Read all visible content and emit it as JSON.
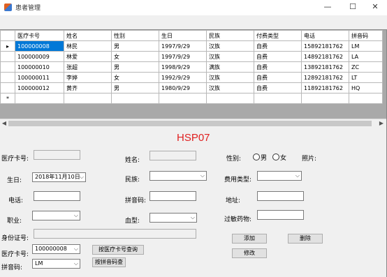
{
  "window": {
    "title": "患者管理",
    "min": "—",
    "max": "☐",
    "close": "✕"
  },
  "grid": {
    "columns": [
      "医疗卡号",
      "姓名",
      "性别",
      "生日",
      "民族",
      "付费类型",
      "电话",
      "拼音码"
    ],
    "rows": [
      [
        "100000008",
        "林民",
        "男",
        "1997/9/29",
        "汉族",
        "自费",
        "15892181762",
        "LM"
      ],
      [
        "100000009",
        "林爱",
        "女",
        "1997/9/29",
        "汉族",
        "自费",
        "14892181762",
        "LA"
      ],
      [
        "100000010",
        "张超",
        "男",
        "1998/9/29",
        "满族",
        "自费",
        "13892181762",
        "ZC"
      ],
      [
        "100000011",
        "李婷",
        "女",
        "1992/9/29",
        "汉族",
        "自费",
        "12892181762",
        "LT"
      ],
      [
        "100000012",
        "黄齐",
        "男",
        "1980/9/29",
        "汉族",
        "自费",
        "11892181762",
        "HQ"
      ]
    ],
    "current_marker": "▸",
    "new_marker": "*"
  },
  "form": {
    "heading": "HSP07",
    "card_label": "医疗卡号:",
    "name_label": "姓名:",
    "gender_label": "性别:",
    "male": "男",
    "female": "女",
    "photo_label": "照片:",
    "birthday_label": "生日:",
    "birthday_value": "2018年11月10日",
    "ethnic_label": "民族:",
    "fee_label": "费用类型:",
    "phone_label": "电话:",
    "pinyin_label": "拼音码:",
    "address_label": "地址:",
    "job_label": "职业:",
    "blood_label": "血型:",
    "allergy_label": "过敏药物:",
    "id_label": "身份证号:",
    "add_btn": "添加",
    "delete_btn": "删除",
    "edit_btn": "修改",
    "search_card_label": "医疗卡号:",
    "search_card_value": "100000008",
    "search_card_btn": "按医疗卡号查询",
    "search_pinyin_label": "拼音码:",
    "search_pinyin_value": "LM",
    "search_pinyin_btn": "按拼音码查"
  }
}
